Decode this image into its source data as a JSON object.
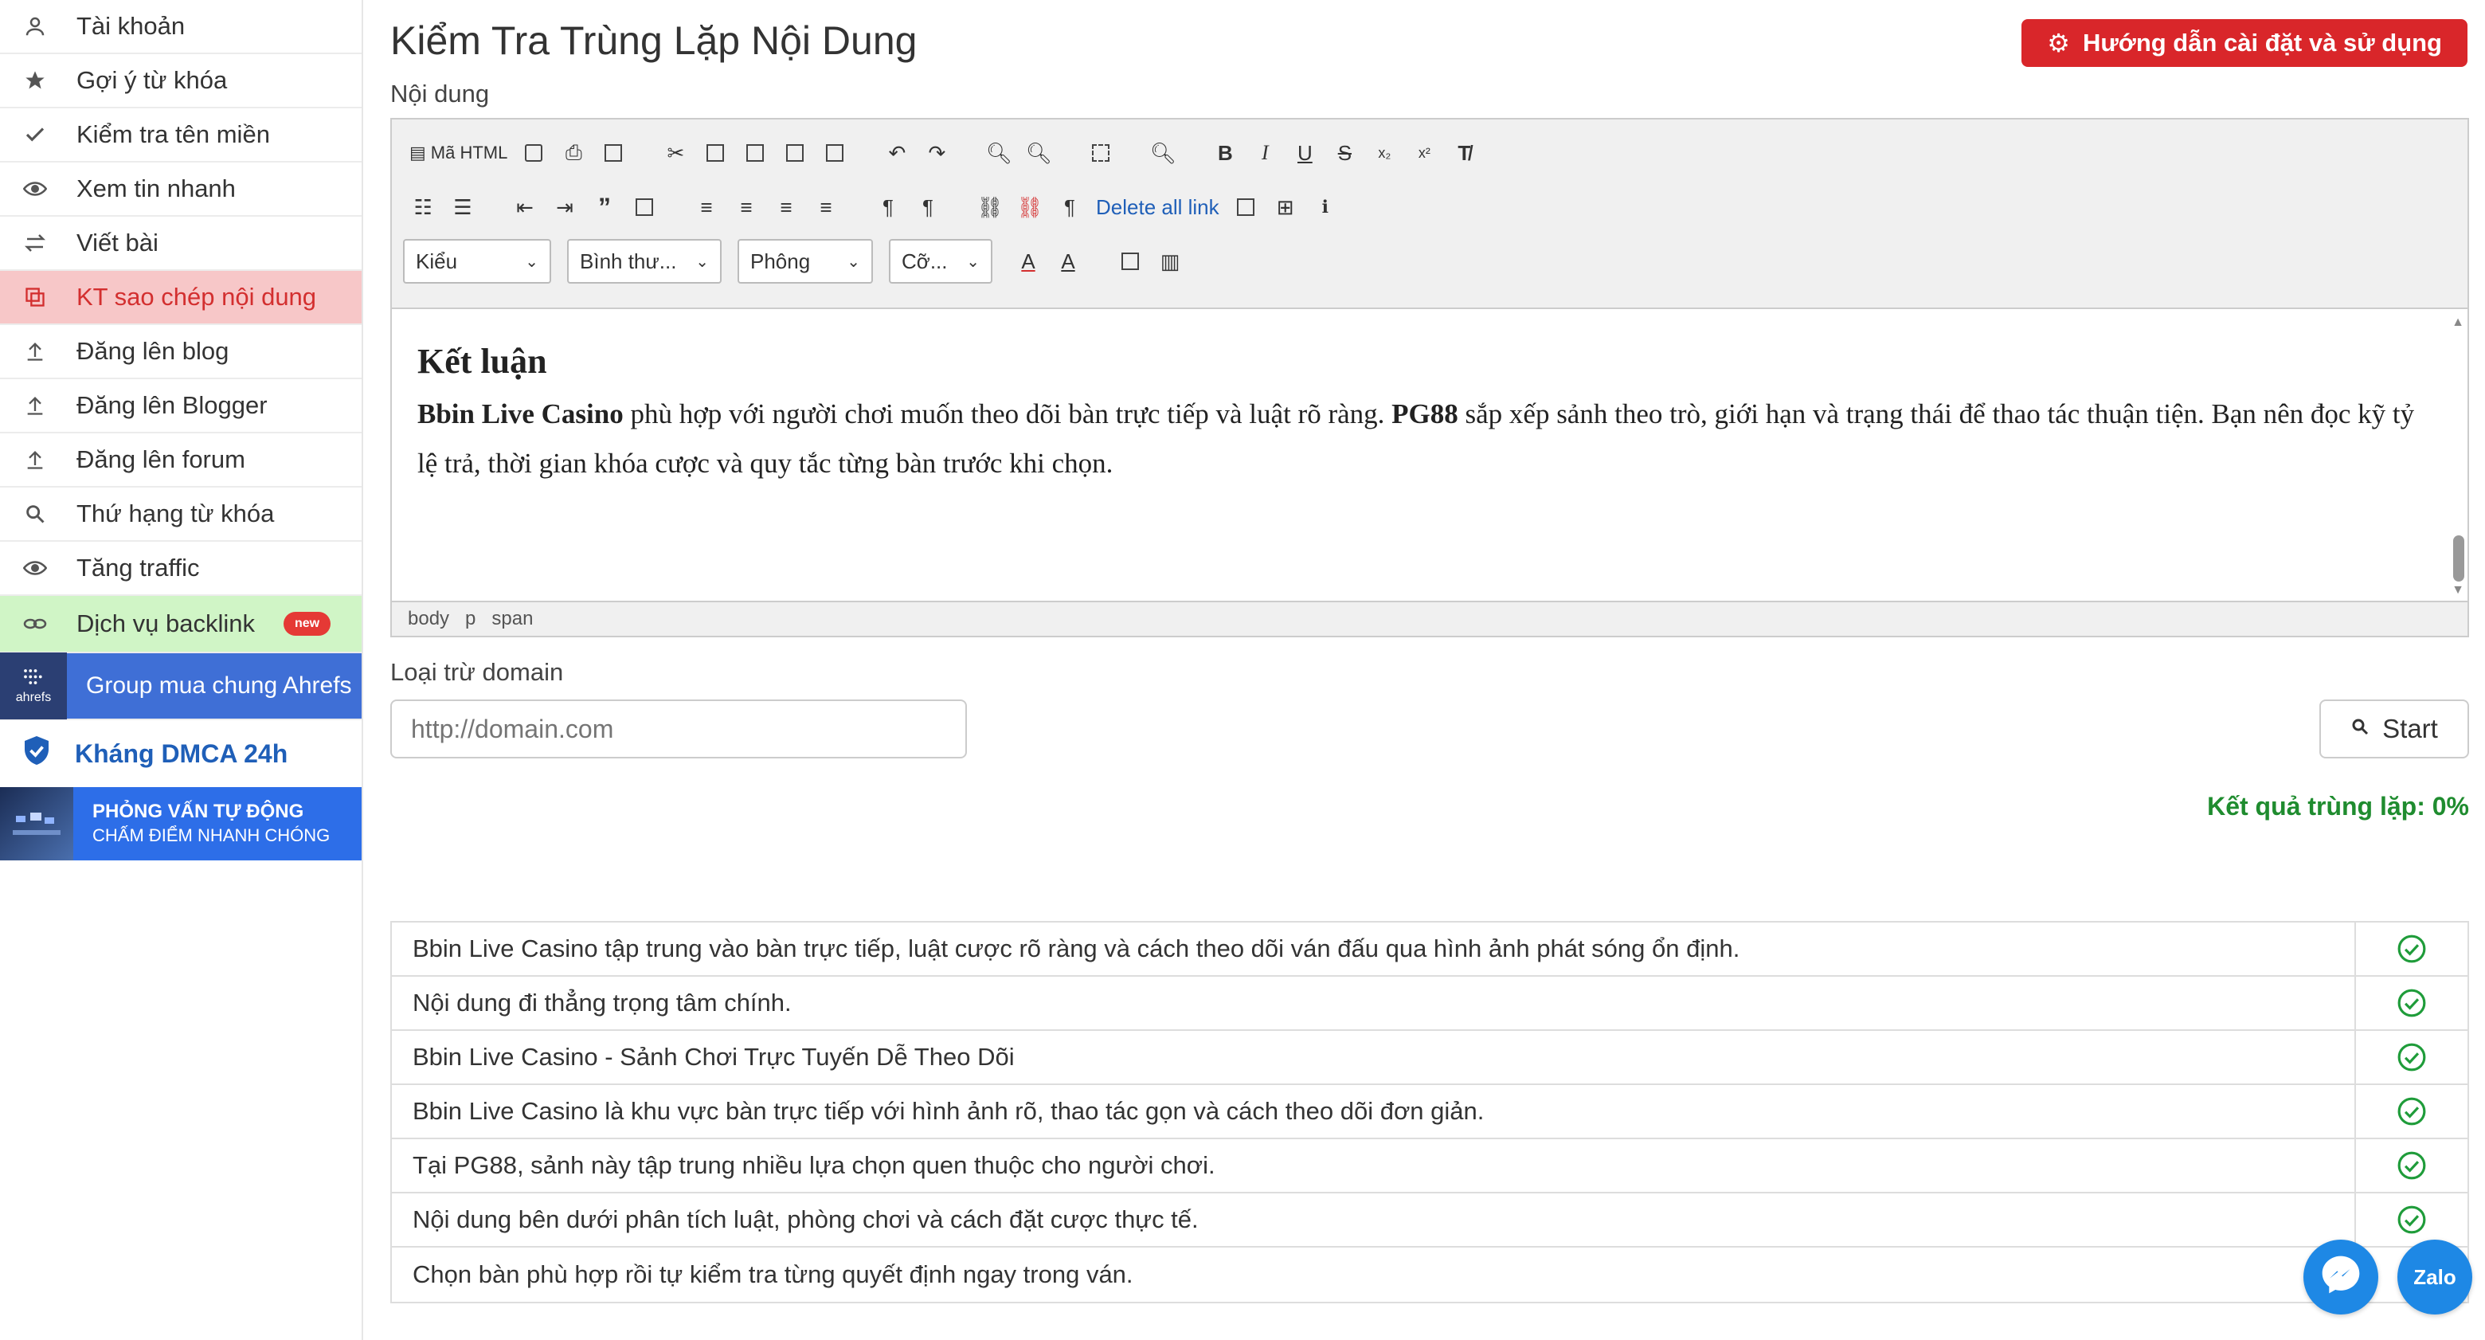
{
  "sidebar": {
    "items": [
      {
        "label": "Tài khoản",
        "icon": "user-icon"
      },
      {
        "label": "Gợi ý từ khóa",
        "icon": "star-icon"
      },
      {
        "label": "Kiểm tra tên miền",
        "icon": "check-icon"
      },
      {
        "label": "Xem tin nhanh",
        "icon": "eye-icon"
      },
      {
        "label": "Viết bài",
        "icon": "swap-icon"
      },
      {
        "label": "KT sao chép nội dung",
        "icon": "copy-icon",
        "active": true
      },
      {
        "label": "Đăng lên blog",
        "icon": "upload-icon"
      },
      {
        "label": "Đăng lên Blogger",
        "icon": "upload-icon"
      },
      {
        "label": "Đăng lên forum",
        "icon": "upload-icon"
      },
      {
        "label": "Thứ hạng từ khóa",
        "icon": "search-icon"
      },
      {
        "label": "Tăng traffic",
        "icon": "eye-icon"
      }
    ],
    "backlink": {
      "label": "Dịch vụ backlink",
      "badge": "new",
      "icon": "link-icon"
    },
    "ahrefs": {
      "logo_text": "ahrefs",
      "label": "Group mua chung Ahrefs"
    },
    "dmca": {
      "label": "Kháng DMCA 24h",
      "icon": "shield-icon"
    },
    "interview": {
      "line1": "PHỎNG VẤN TỰ ĐỘNG",
      "line2": "CHẤM ĐIỂM NHANH CHÓNG"
    }
  },
  "header": {
    "title": "Kiểm Tra Trùng Lặp Nội Dung",
    "guide_button": "Hướng dẫn cài đặt và sử dụng",
    "content_label": "Nội dung"
  },
  "toolbar": {
    "html_label": "Mã HTML",
    "delete_links_label": "Delete all link",
    "style_select": "Kiểu",
    "format_select": "Bình thư...",
    "font_select": "Phông",
    "size_select": "Cỡ..."
  },
  "editor": {
    "heading": "Kết luận",
    "bold1": "Bbin Live Casino",
    "text1": " phù hợp với người chơi muốn theo dõi bàn trực tiếp và luật rõ ràng. ",
    "bold2": "PG88",
    "text2": " sắp xếp sảnh theo trò, giới hạn và trạng thái để thao tác thuận tiện. Bạn nên đọc kỹ tỷ lệ trả, thời gian khóa cược và quy tắc từng bàn trước khi chọn.",
    "path": [
      "body",
      "p",
      "span"
    ]
  },
  "exclude": {
    "label": "Loại trừ domain",
    "placeholder": "http://domain.com",
    "start_label": "Start"
  },
  "result": {
    "text": "Kết quả trùng lặp: 0%",
    "color": "#1f8c2f"
  },
  "results_table": [
    "Bbin Live Casino tập trung vào bàn trực tiếp, luật cược rõ ràng và cách theo dõi ván đấu qua hình ảnh phát sóng ổn định.",
    "Nội dung đi thẳng trọng tâm chính.",
    "Bbin Live Casino - Sảnh Chơi Trực Tuyến Dễ Theo Dõi",
    "Bbin Live Casino là khu vực bàn trực tiếp với hình ảnh rõ, thao tác gọn và cách theo dõi đơn giản.",
    "Tại PG88, sảnh này tập trung nhiều lựa chọn quen thuộc cho người chơi.",
    "Nội dung bên dưới phân tích luật, phòng chơi và cách đặt cược thực tế.",
    "Chọn bàn phù hợp rồi tự kiểm tra từng quyết định ngay trong ván."
  ],
  "floating": {
    "messenger_icon": "messenger-icon",
    "zalo_label": "Zalo"
  },
  "colors": {
    "accent_red": "#d9262a",
    "active_bg": "#f7c7c8",
    "backlink_bg": "#d0f5c6",
    "link_blue": "#1f5fb8",
    "check_green": "#1f9c3a"
  }
}
